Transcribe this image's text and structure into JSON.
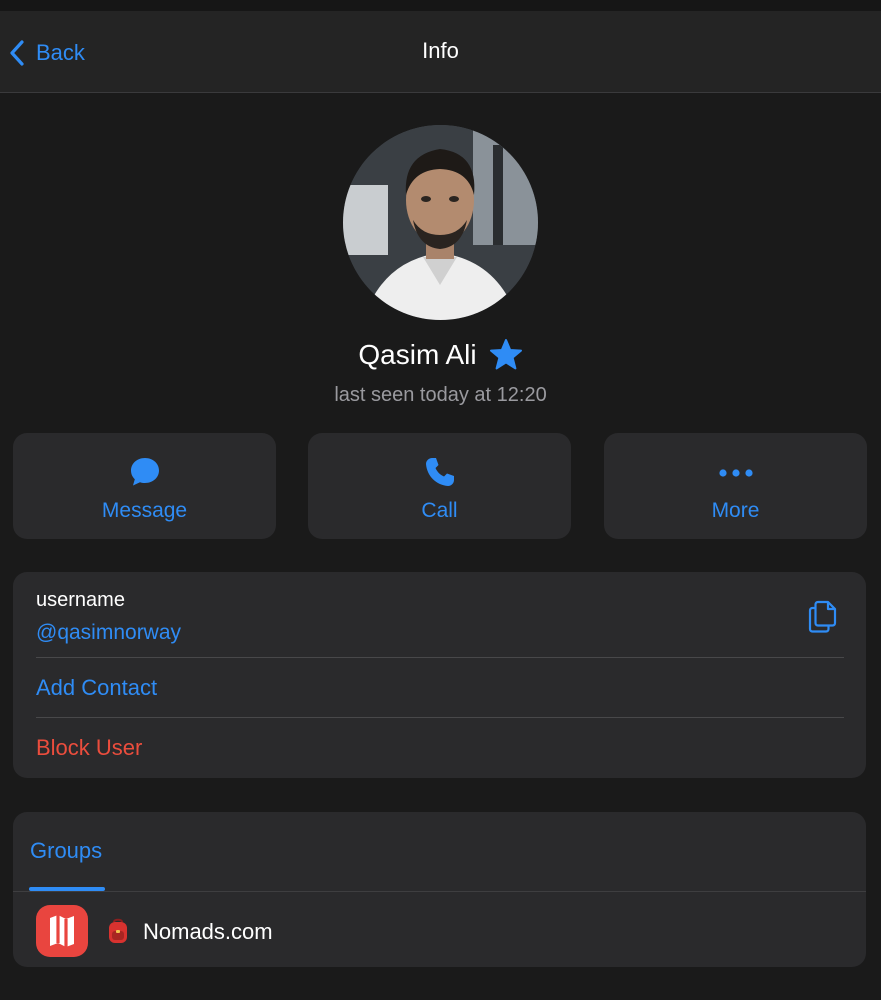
{
  "navbar": {
    "back_label": "Back",
    "title": "Info",
    "back_icon": "chevron-left-icon"
  },
  "profile": {
    "name": "Qasim Ali",
    "badge_icon": "premium-star-icon",
    "status": "last seen today at 12:20"
  },
  "actions": [
    {
      "label": "Message",
      "icon": "message-bubble-icon"
    },
    {
      "label": "Call",
      "icon": "phone-icon"
    },
    {
      "label": "More",
      "icon": "more-dots-icon"
    }
  ],
  "info": {
    "username_label": "username",
    "username_value": "@qasimnorway",
    "copy_icon": "copy-icon",
    "add_contact": "Add Contact",
    "block_user": "Block User"
  },
  "groups": {
    "tab_label": "Groups",
    "items": [
      {
        "name": "Nomads.com",
        "emoji": "backpack-emoji",
        "avatar_icon": "nomads-logo-icon"
      }
    ]
  },
  "colors": {
    "accent": "#2f8cf5",
    "danger": "#eb4d3d",
    "background": "#1a1a1a",
    "card": "#2a2a2c",
    "group_avatar": "#e9453f"
  }
}
